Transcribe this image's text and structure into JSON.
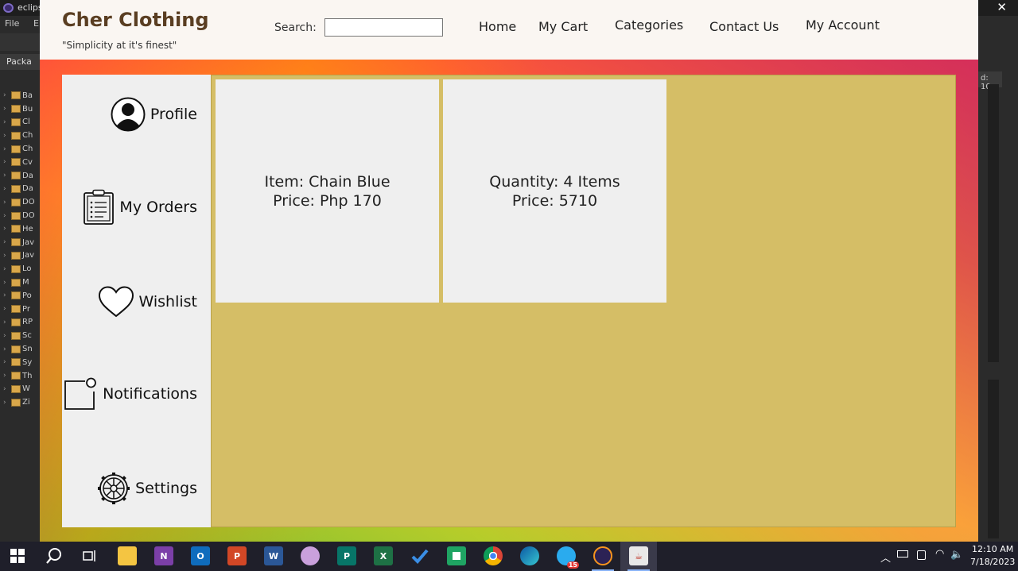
{
  "eclipse": {
    "title": "eclips",
    "menu": [
      "File",
      "E"
    ],
    "package_tab": "Packa",
    "right_panel": "d: 10",
    "project_items": [
      "Ba",
      "Bu",
      "Cl",
      "Ch",
      "Ch",
      "Cv",
      "Da",
      "Da",
      "DO",
      "DO",
      "He",
      "Jav",
      "Jav",
      "Lo",
      "M",
      "Po",
      "Pr",
      "RP",
      "Sc",
      "Sn",
      "Sy",
      "Th",
      "W",
      "Zi"
    ]
  },
  "header": {
    "brand_title": "Cher Clothing",
    "tagline": "\"Simplicity at it's finest\"",
    "search_label": "Search:",
    "search_value": "",
    "nav": {
      "home": "Home",
      "cart": "My Cart",
      "categories": "Categories",
      "contact": "Contact Us",
      "account": "My Account"
    }
  },
  "sidebar": {
    "profile": "Profile",
    "orders": "My Orders",
    "wishlist": "Wishlist",
    "notifications": "Notifications",
    "settings": "Settings"
  },
  "cards": {
    "item": {
      "line1": "Item: Chain Blue",
      "line2": "Price: Php 170"
    },
    "summary": {
      "line1": "Quantity: 4 Items",
      "line2": "Price: 5710"
    }
  },
  "colors": {
    "content_bg": "#d5be66",
    "card_bg": "#efefef",
    "header_bg": "#faf6f2",
    "brand": "#5a3e22"
  },
  "taskbar": {
    "time": "12:10 AM",
    "date": "7/18/2023",
    "telegram_badge": "15",
    "icons": [
      "windows-start-icon",
      "search-icon",
      "task-view-icon",
      "file-explorer-icon",
      "onenote-icon",
      "outlook-icon",
      "powerpoint-icon",
      "word-icon",
      "paint-icon",
      "publisher-icon",
      "excel-icon",
      "todo-icon",
      "sheets-icon",
      "chrome-icon",
      "edge-icon",
      "telegram-icon",
      "eclipse-icon",
      "java-icon"
    ],
    "icon_labels": {
      "onenote": "N",
      "outlook": "O",
      "powerpoint": "P",
      "word": "W",
      "publisher": "P",
      "excel": "X"
    }
  }
}
